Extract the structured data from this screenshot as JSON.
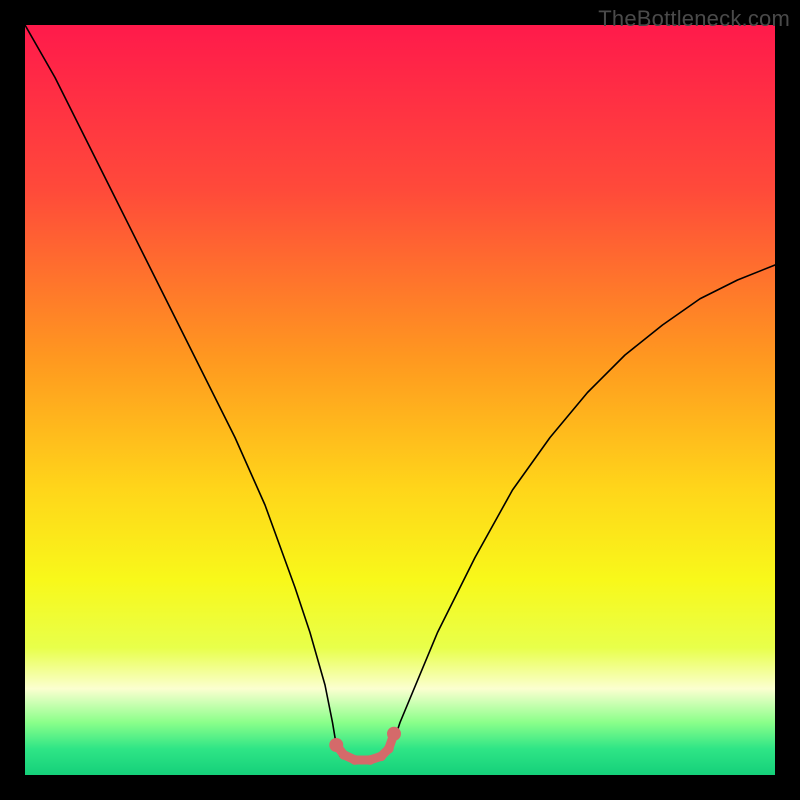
{
  "watermark": "TheBottleneck.com",
  "chart_data": {
    "type": "line",
    "title": "",
    "xlabel": "",
    "ylabel": "",
    "xlim": [
      0,
      100
    ],
    "ylim": [
      0,
      100
    ],
    "background_gradient": {
      "stops": [
        {
          "offset": 0.0,
          "color": "#ff1a4b"
        },
        {
          "offset": 0.22,
          "color": "#ff4a3a"
        },
        {
          "offset": 0.45,
          "color": "#ff9a1f"
        },
        {
          "offset": 0.62,
          "color": "#ffd61a"
        },
        {
          "offset": 0.74,
          "color": "#f8f81a"
        },
        {
          "offset": 0.83,
          "color": "#e8ff4a"
        },
        {
          "offset": 0.885,
          "color": "#fbffd0"
        },
        {
          "offset": 0.93,
          "color": "#8aff8a"
        },
        {
          "offset": 0.965,
          "color": "#2fe586"
        },
        {
          "offset": 1.0,
          "color": "#15d07a"
        }
      ]
    },
    "series": [
      {
        "name": "bottleneck-curve",
        "color": "#000000",
        "width": 1.6,
        "x": [
          0,
          4,
          8,
          12,
          16,
          20,
          24,
          28,
          32,
          36,
          38,
          40,
          41,
          41.5,
          42,
          44,
          46,
          48,
          49,
          50,
          55,
          60,
          65,
          70,
          75,
          80,
          85,
          90,
          95,
          100
        ],
        "y": [
          100,
          93,
          85,
          77,
          69,
          61,
          53,
          45,
          36,
          25,
          19,
          12,
          7,
          4,
          2.5,
          2,
          2,
          2.5,
          4,
          7,
          19,
          29,
          38,
          45,
          51,
          56,
          60,
          63.5,
          66,
          68
        ]
      }
    ],
    "annotations": [
      {
        "name": "valley-highlight",
        "color": "#d46a6a",
        "width": 9,
        "dots_radius": 7,
        "x": [
          41.5,
          42.5,
          44,
          46,
          47.5,
          48.5,
          49.2
        ],
        "y": [
          4.0,
          2.7,
          2.0,
          2.0,
          2.5,
          3.5,
          5.5
        ]
      }
    ]
  }
}
